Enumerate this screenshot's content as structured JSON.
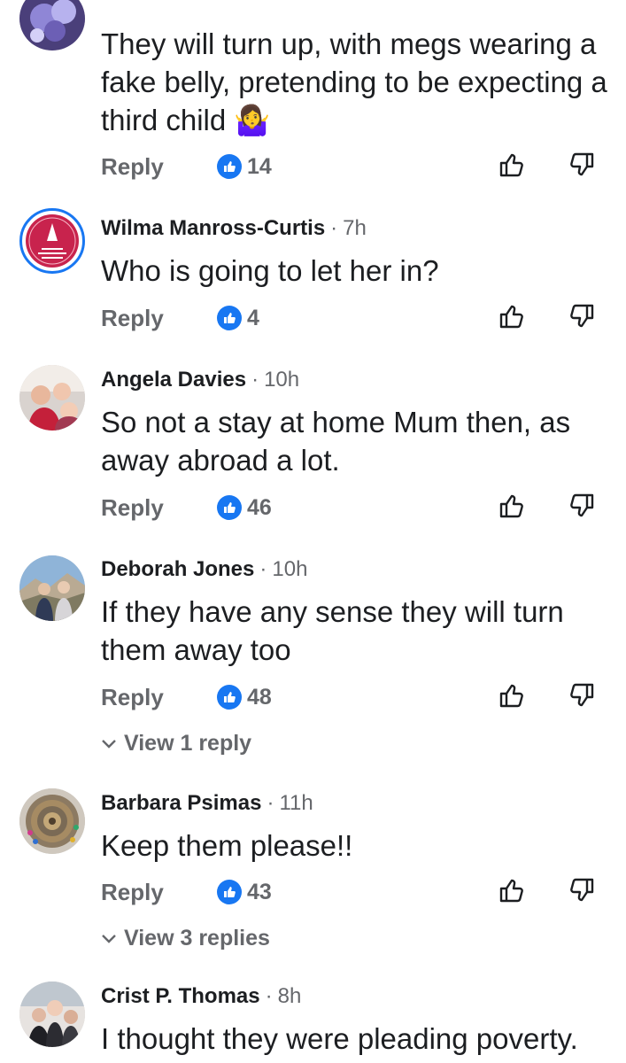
{
  "comments": [
    {
      "text": "They will turn up, with megs wearing a fake belly, pretending to be expecting a third child",
      "emoji": "🤷‍♀️",
      "reply_label": "Reply",
      "likes": "14"
    },
    {
      "author": "Wilma Manross-Curtis",
      "time": "7h",
      "text": "Who is going to let her in?",
      "reply_label": "Reply",
      "likes": "4"
    },
    {
      "author": "Angela Davies",
      "time": "10h",
      "text": "So not a stay at home Mum then, as away abroad a lot.",
      "reply_label": "Reply",
      "likes": "46"
    },
    {
      "author": "Deborah Jones",
      "time": "10h",
      "text": "If they have any sense they will turn them away too",
      "reply_label": "Reply",
      "likes": "48",
      "view_replies": "View 1 reply"
    },
    {
      "author": "Barbara Psimas",
      "time": "11h",
      "text": "Keep them please!!",
      "reply_label": "Reply",
      "likes": "43",
      "view_replies": "View 3 replies"
    },
    {
      "author": "Crist P. Thomas",
      "time": "8h",
      "text": "I thought they were pleading poverty."
    }
  ],
  "separator": "·",
  "colors": {
    "like_blue": "#1877f2",
    "secondary_text": "#65676b",
    "primary_text": "#1c1e21"
  }
}
